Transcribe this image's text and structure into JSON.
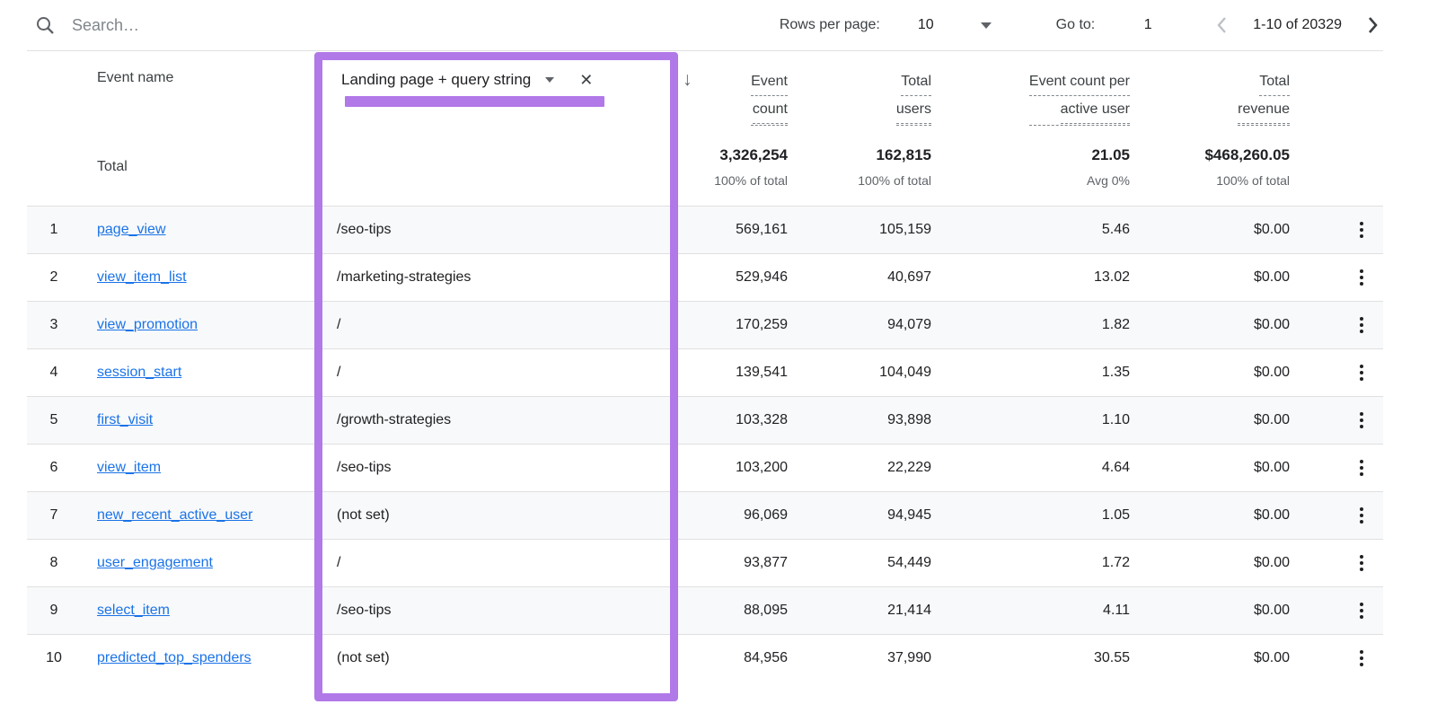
{
  "toolbar": {
    "search_placeholder": "Search…",
    "rows_per_page_label": "Rows per page:",
    "rows_per_page_value": "10",
    "go_to_label": "Go to:",
    "go_to_value": "1",
    "pagination_range": "1-10 of 20329"
  },
  "columns": {
    "event_name": "Event name",
    "secondary_dimension": "Landing page + query string",
    "event_count": [
      "Event",
      "count"
    ],
    "total_users": [
      "Total",
      "users"
    ],
    "event_count_per_active_user": [
      "Event count per",
      "active user"
    ],
    "total_revenue": [
      "Total",
      "revenue"
    ]
  },
  "totals": {
    "label": "Total",
    "event_count": "3,326,254",
    "event_count_sub": "100% of total",
    "total_users": "162,815",
    "total_users_sub": "100% of total",
    "per_active_user": "21.05",
    "per_active_user_sub": "Avg 0%",
    "total_revenue": "$468,260.05",
    "total_revenue_sub": "100% of total"
  },
  "rows": [
    {
      "n": "1",
      "event": "page_view",
      "dim": "/seo-tips",
      "count": "569,161",
      "users": "105,159",
      "per_user": "5.46",
      "revenue": "$0.00"
    },
    {
      "n": "2",
      "event": "view_item_list",
      "dim": "/marketing-strategies",
      "count": "529,946",
      "users": "40,697",
      "per_user": "13.02",
      "revenue": "$0.00"
    },
    {
      "n": "3",
      "event": "view_promotion",
      "dim": "/",
      "count": "170,259",
      "users": "94,079",
      "per_user": "1.82",
      "revenue": "$0.00"
    },
    {
      "n": "4",
      "event": "session_start",
      "dim": "/",
      "count": "139,541",
      "users": "104,049",
      "per_user": "1.35",
      "revenue": "$0.00"
    },
    {
      "n": "5",
      "event": "first_visit",
      "dim": "/growth-strategies",
      "count": "103,328",
      "users": "93,898",
      "per_user": "1.10",
      "revenue": "$0.00"
    },
    {
      "n": "6",
      "event": "view_item",
      "dim": "/seo-tips",
      "count": "103,200",
      "users": "22,229",
      "per_user": "4.64",
      "revenue": "$0.00"
    },
    {
      "n": "7",
      "event": "new_recent_active_user",
      "dim": "(not set)",
      "count": "96,069",
      "users": "94,945",
      "per_user": "1.05",
      "revenue": "$0.00"
    },
    {
      "n": "8",
      "event": "user_engagement",
      "dim": "/",
      "count": "93,877",
      "users": "54,449",
      "per_user": "1.72",
      "revenue": "$0.00"
    },
    {
      "n": "9",
      "event": "select_item",
      "dim": "/seo-tips",
      "count": "88,095",
      "users": "21,414",
      "per_user": "4.11",
      "revenue": "$0.00"
    },
    {
      "n": "10",
      "event": "predicted_top_spenders",
      "dim": "(not set)",
      "count": "84,956",
      "users": "37,990",
      "per_user": "30.55",
      "revenue": "$0.00"
    }
  ],
  "icons": {
    "close": "✕",
    "sort_descending": "↓"
  },
  "colors": {
    "annotation_purple": "#b178e8",
    "link_blue": "#1a73e8",
    "row_stripe": "#f8f9fa",
    "divider": "#e0e0e0"
  }
}
